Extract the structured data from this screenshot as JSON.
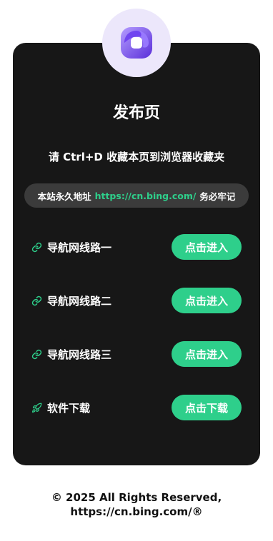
{
  "page": {
    "title": "发布页",
    "subtitle": "请 Ctrl+D 收藏本页到浏览器收藏夹"
  },
  "address": {
    "prefix": "本站永久地址",
    "url": "https://cn.bing.com/",
    "suffix": "务必牢记"
  },
  "links": [
    {
      "icon": "link-icon",
      "label": "导航网线路一",
      "button": "点击进入"
    },
    {
      "icon": "link-icon",
      "label": "导航网线路二",
      "button": "点击进入"
    },
    {
      "icon": "link-icon",
      "label": "导航网线路三",
      "button": "点击进入"
    },
    {
      "icon": "rocket-icon",
      "label": "软件下载",
      "button": "点击下载"
    }
  ],
  "footer": {
    "line1": "© 2025 All Rights Reserved,",
    "line2": "https://cn.bing.com/®"
  },
  "colors": {
    "card_bg": "#171717",
    "accent": "#2ecf8b",
    "pill_bg": "#3b3b3b",
    "logo_bg": "#ece7fb",
    "logo_purple": "#7c4dff"
  }
}
